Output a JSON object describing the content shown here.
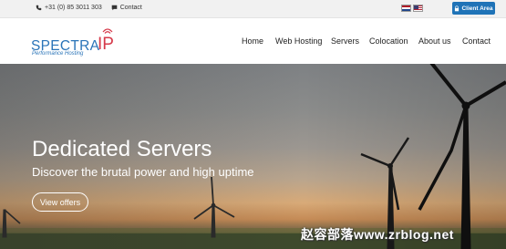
{
  "topbar": {
    "phone": "+31 (0) 85 3011 303",
    "contact": "Contact",
    "client_area": "Client Area",
    "languages": [
      "nl-flag",
      "us-flag"
    ]
  },
  "header": {
    "logo_brand": "SPECTRA",
    "logo_ip": "IP",
    "logo_tagline": "Performance Hosting",
    "nav": [
      "Home",
      "Web Hosting",
      "Servers",
      "Colocation",
      "About us",
      "Contact"
    ]
  },
  "hero": {
    "title": "Dedicated Servers",
    "subtitle": "Discover the brutal power and high uptime",
    "cta": "View offers",
    "watermark": "赵容部落www.zrblog.net"
  },
  "colors": {
    "accent": "#1f73b7",
    "logo_blue": "#2a74b8",
    "logo_red": "#d63a4a"
  },
  "icons": {
    "phone": "phone-icon",
    "contact": "chat-icon",
    "client_area": "lock-icon"
  }
}
